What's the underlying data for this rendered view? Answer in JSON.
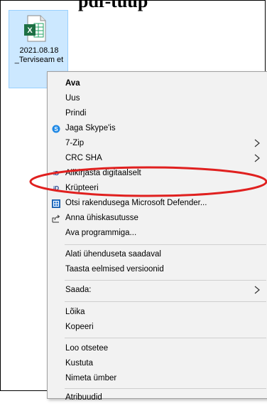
{
  "header": {
    "text": "pdf-tüüp"
  },
  "desktop": {
    "file_label": "2021.08.18 _Terviseam et",
    "file_icon": "excel-file-icon"
  },
  "menu": {
    "items": [
      {
        "label": "Ava",
        "bold": true,
        "icon": ""
      },
      {
        "label": "Uus",
        "icon": ""
      },
      {
        "label": "Prindi",
        "icon": ""
      },
      {
        "label": "Jaga Skype'is",
        "icon": "skype-icon"
      },
      {
        "label": "7-Zip",
        "icon": "",
        "submenu": true
      },
      {
        "label": "CRC SHA",
        "icon": "",
        "submenu": true
      },
      {
        "label": "Allkirjasta digitaalselt",
        "icon": "id-icon"
      },
      {
        "label": "Krüpteeri",
        "icon": "id-icon"
      },
      {
        "label": "Otsi rakendusega Microsoft Defender...",
        "icon": "defender-icon"
      },
      {
        "label": "Anna ühiskasutusse",
        "icon": "share-icon"
      },
      {
        "label": "Ava programmiga...",
        "icon": ""
      },
      {
        "label": "Alati ühenduseta saadaval",
        "icon": ""
      },
      {
        "label": "Taasta eelmised versioonid",
        "icon": ""
      },
      {
        "label": "Saada:",
        "icon": "",
        "submenu": true
      },
      {
        "label": "Lõika",
        "icon": ""
      },
      {
        "label": "Kopeeri",
        "icon": ""
      },
      {
        "label": "Loo otsetee",
        "icon": ""
      },
      {
        "label": "Kustuta",
        "icon": ""
      },
      {
        "label": "Nimeta ümber",
        "icon": ""
      },
      {
        "label": "Atribuudid",
        "icon": ""
      }
    ]
  },
  "colors": {
    "highlight_ellipse": "#e0201f",
    "excel_green": "#1d7044",
    "skype_blue": "#1e88e5",
    "menu_bg": "#f2f2f2"
  }
}
